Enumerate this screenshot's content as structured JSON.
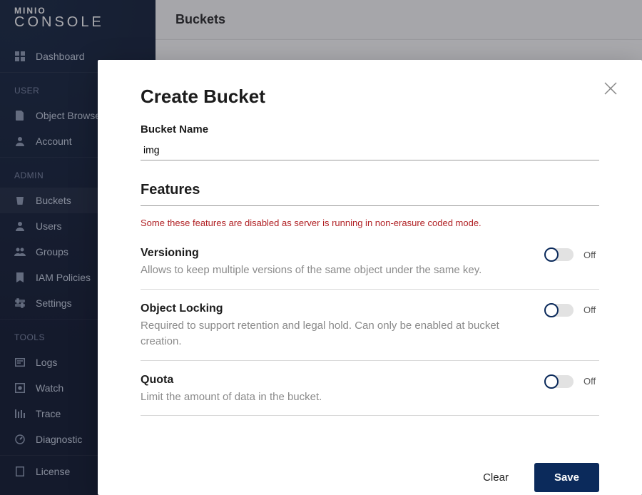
{
  "brand": {
    "line1": "MINIO",
    "line2": "CONSOLE"
  },
  "page": {
    "title": "Buckets"
  },
  "sidebar": {
    "dashboard": "Dashboard",
    "group_user": "USER",
    "object_browser": "Object Browser",
    "account": "Account",
    "group_admin": "ADMIN",
    "buckets": "Buckets",
    "users": "Users",
    "groups": "Groups",
    "iam_policies": "IAM Policies",
    "settings": "Settings",
    "group_tools": "TOOLS",
    "logs": "Logs",
    "watch": "Watch",
    "trace": "Trace",
    "diagnostic": "Diagnostic",
    "license": "License"
  },
  "modal": {
    "title": "Create Bucket",
    "bucket_name_label": "Bucket Name",
    "bucket_name_value": "img",
    "features_heading": "Features",
    "warning": "Some these features are disabled as server is running in non-erasure coded mode.",
    "versioning": {
      "title": "Versioning",
      "desc": "Allows to keep multiple versions of the same object under the same key.",
      "state": "Off"
    },
    "object_locking": {
      "title": "Object Locking",
      "desc": "Required to support retention and legal hold. Can only be enabled at bucket creation.",
      "state": "Off"
    },
    "quota": {
      "title": "Quota",
      "desc": "Limit the amount of data in the bucket.",
      "state": "Off"
    },
    "clear": "Clear",
    "save": "Save"
  }
}
